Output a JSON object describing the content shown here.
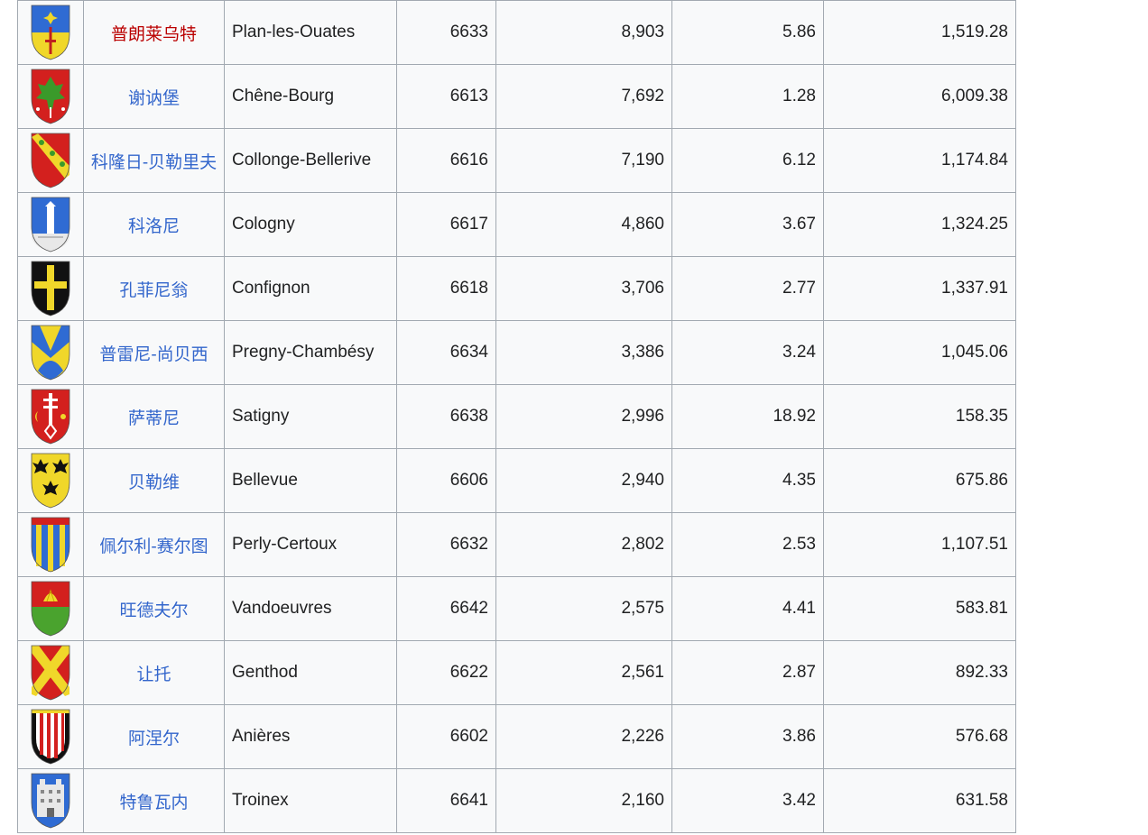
{
  "table": {
    "rows": [
      {
        "zh": "普朗莱乌特",
        "zh_redlink": true,
        "name": "Plan-les-Ouates",
        "code": "6633",
        "population": "8,903",
        "area": "5.86",
        "density": "1,519.28",
        "arms_icon": "plan-les-ouates-coat-of-arms-icon"
      },
      {
        "zh": "谢讷堡",
        "zh_redlink": false,
        "name": "Chêne-Bourg",
        "code": "6613",
        "population": "7,692",
        "area": "1.28",
        "density": "6,009.38",
        "arms_icon": "chene-bourg-coat-of-arms-icon"
      },
      {
        "zh": "科隆日-贝勒里夫",
        "zh_redlink": false,
        "name": "Collonge-Bellerive",
        "code": "6616",
        "population": "7,190",
        "area": "6.12",
        "density": "1,174.84",
        "arms_icon": "collonge-bellerive-coat-of-arms-icon"
      },
      {
        "zh": "科洛尼",
        "zh_redlink": false,
        "name": "Cologny",
        "code": "6617",
        "population": "4,860",
        "area": "3.67",
        "density": "1,324.25",
        "arms_icon": "cologny-coat-of-arms-icon"
      },
      {
        "zh": "孔菲尼翁",
        "zh_redlink": false,
        "name": "Confignon",
        "code": "6618",
        "population": "3,706",
        "area": "2.77",
        "density": "1,337.91",
        "arms_icon": "confignon-coat-of-arms-icon"
      },
      {
        "zh": "普雷尼-尚贝西",
        "zh_redlink": false,
        "name": "Pregny-Chambésy",
        "code": "6634",
        "population": "3,386",
        "area": "3.24",
        "density": "1,045.06",
        "arms_icon": "pregny-chambesy-coat-of-arms-icon"
      },
      {
        "zh": "萨蒂尼",
        "zh_redlink": false,
        "name": "Satigny",
        "code": "6638",
        "population": "2,996",
        "area": "18.92",
        "density": "158.35",
        "arms_icon": "satigny-coat-of-arms-icon"
      },
      {
        "zh": "贝勒维",
        "zh_redlink": false,
        "name": "Bellevue",
        "code": "6606",
        "population": "2,940",
        "area": "4.35",
        "density": "675.86",
        "arms_icon": "bellevue-coat-of-arms-icon"
      },
      {
        "zh": "佩尔利-赛尔图",
        "zh_redlink": false,
        "name": "Perly-Certoux",
        "code": "6632",
        "population": "2,802",
        "area": "2.53",
        "density": "1,107.51",
        "arms_icon": "perly-certoux-coat-of-arms-icon"
      },
      {
        "zh": "旺德夫尔",
        "zh_redlink": false,
        "name": "Vandoeuvres",
        "code": "6642",
        "population": "2,575",
        "area": "4.41",
        "density": "583.81",
        "arms_icon": "vandoeuvres-coat-of-arms-icon"
      },
      {
        "zh": "让托",
        "zh_redlink": false,
        "name": "Genthod",
        "code": "6622",
        "population": "2,561",
        "area": "2.87",
        "density": "892.33",
        "arms_icon": "genthod-coat-of-arms-icon"
      },
      {
        "zh": "阿涅尔",
        "zh_redlink": false,
        "name": "Anières",
        "code": "6602",
        "population": "2,226",
        "area": "3.86",
        "density": "576.68",
        "arms_icon": "anieres-coat-of-arms-icon"
      },
      {
        "zh": "特鲁瓦内",
        "zh_redlink": false,
        "name": "Troinex",
        "code": "6641",
        "population": "2,160",
        "area": "3.42",
        "density": "631.58",
        "arms_icon": "troinex-coat-of-arms-icon"
      }
    ]
  },
  "colors": {
    "link": "#3366cc",
    "redlink": "#ba0000",
    "border": "#a2a9b1",
    "cell_bg": "#f8f9fa",
    "text": "#202122"
  }
}
